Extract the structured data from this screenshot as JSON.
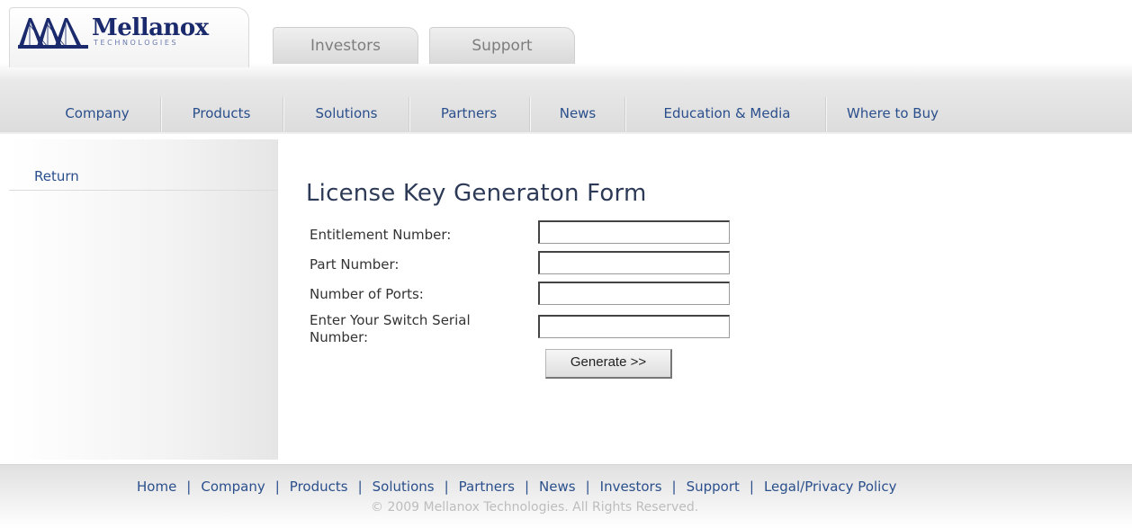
{
  "brand": {
    "name": "Mellanox",
    "subtitle": "TECHNOLOGIES",
    "color": "#1a2a6c"
  },
  "top_tabs": [
    {
      "label": "Investors"
    },
    {
      "label": "Support"
    }
  ],
  "nav": {
    "items": [
      {
        "label": "Company"
      },
      {
        "label": "Products"
      },
      {
        "label": "Solutions"
      },
      {
        "label": "Partners"
      },
      {
        "label": "News"
      },
      {
        "label": "Education & Media"
      },
      {
        "label": "Where to Buy"
      }
    ]
  },
  "sidebar": {
    "return_label": "Return"
  },
  "form": {
    "title": "License Key Generaton Form",
    "fields": [
      {
        "label": "Entitlement Number:",
        "value": ""
      },
      {
        "label": "Part Number:",
        "value": ""
      },
      {
        "label": "Number of Ports:",
        "value": ""
      },
      {
        "label_line1": "Enter Your Switch Serial",
        "label_line2": "Number:",
        "value": ""
      }
    ],
    "submit_label": "Generate >>"
  },
  "footer": {
    "links": [
      {
        "label": "Home"
      },
      {
        "label": "Company"
      },
      {
        "label": "Products"
      },
      {
        "label": "Solutions"
      },
      {
        "label": "Partners"
      },
      {
        "label": "News"
      },
      {
        "label": "Investors"
      },
      {
        "label": "Support"
      },
      {
        "label": "Legal/Privacy Policy"
      }
    ],
    "separator": "|",
    "copyright": "© 2009 Mellanox Technologies. All Rights Reserved."
  },
  "colors": {
    "link": "#2a4f8c",
    "title": "#2d3a57"
  }
}
